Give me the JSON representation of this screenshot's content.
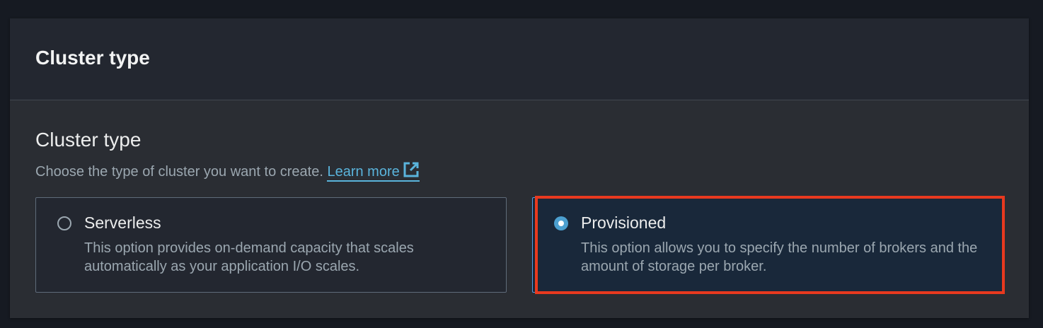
{
  "panel": {
    "header_title": "Cluster type",
    "field_label": "Cluster type",
    "description": "Choose the type of cluster you want to create.",
    "learn_more": "Learn more",
    "options": [
      {
        "label": "Serverless",
        "description": "This option provides on-demand capacity that scales automatically as your application I/O scales.",
        "selected": false
      },
      {
        "label": "Provisioned",
        "description": "This option allows you to specify the number of brokers and the amount of storage per broker.",
        "selected": true
      }
    ]
  },
  "colors": {
    "accent": "#539fe5",
    "highlight": "#e8391f"
  }
}
